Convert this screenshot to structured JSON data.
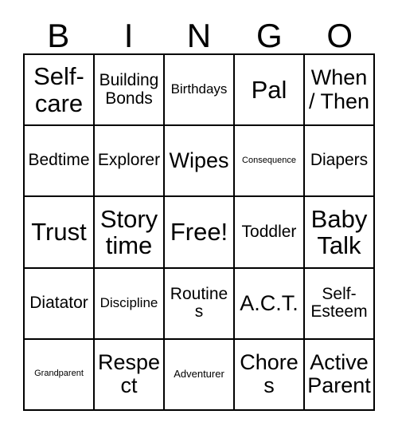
{
  "card": {
    "title": "Bingo Card",
    "header_letters": [
      "B",
      "I",
      "N",
      "G",
      "O"
    ],
    "columns": 5,
    "rows": 5,
    "colors": {
      "border": "#000000",
      "background": "#ffffff",
      "text": "#000000"
    },
    "cells": [
      [
        {
          "label": "Self-care",
          "size": "s-xl"
        },
        {
          "label": "Building Bonds",
          "size": "s-md"
        },
        {
          "label": "Birthdays",
          "size": "s-sm"
        },
        {
          "label": "Pal",
          "size": "s-xl"
        },
        {
          "label": "When / Then",
          "size": "s-lg"
        }
      ],
      [
        {
          "label": "Bedtime",
          "size": "s-md"
        },
        {
          "label": "Explorer",
          "size": "s-md"
        },
        {
          "label": "Wipes",
          "size": "s-lg"
        },
        {
          "label": "Consequence",
          "size": "s-xxs"
        },
        {
          "label": "Diapers",
          "size": "s-md"
        }
      ],
      [
        {
          "label": "Trust",
          "size": "s-xl"
        },
        {
          "label": "Story time",
          "size": "s-xl"
        },
        {
          "label": "Free!",
          "size": "s-xl"
        },
        {
          "label": "Toddler",
          "size": "s-md"
        },
        {
          "label": "Baby Talk",
          "size": "s-xl"
        }
      ],
      [
        {
          "label": "Diatator",
          "size": "s-md"
        },
        {
          "label": "Discipline",
          "size": "s-sm"
        },
        {
          "label": "Routines",
          "size": "s-md"
        },
        {
          "label": "A.C.T.",
          "size": "s-lg"
        },
        {
          "label": "Self-Esteem",
          "size": "s-md"
        }
      ],
      [
        {
          "label": "Grandparent",
          "size": "s-xxs"
        },
        {
          "label": "Respect",
          "size": "s-lg"
        },
        {
          "label": "Adventurer",
          "size": "s-xs"
        },
        {
          "label": "Chores",
          "size": "s-lg"
        },
        {
          "label": "Active Parent",
          "size": "s-lg"
        }
      ]
    ]
  }
}
